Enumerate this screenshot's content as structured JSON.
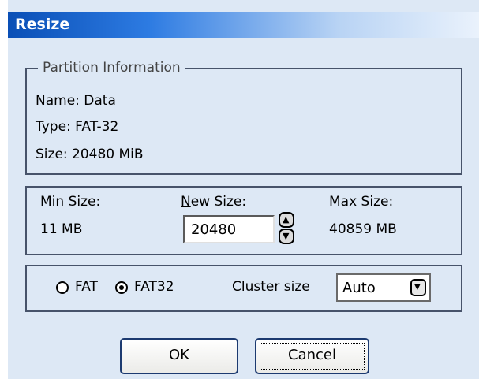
{
  "title": "Resize",
  "partition_info": {
    "legend": "Partition Information",
    "name": "Name: Data",
    "type": "Type: FAT-32",
    "size": "Size: 20480 MiB"
  },
  "sizes": {
    "min_label": "Min Size:",
    "min_value": "11 MB",
    "new_label": "New Size:",
    "new_value": "20480",
    "max_label": "Max Size:",
    "max_value": "40859 MB"
  },
  "fs": {
    "fat_label": "FAT",
    "fat32_label": "FAT32",
    "selected": "FAT32",
    "cluster_label": "Cluster size",
    "cluster_value": "Auto"
  },
  "buttons": {
    "ok": "OK",
    "cancel": "Cancel"
  },
  "icons": [
    "spin-up-icon",
    "spin-down-icon",
    "dropdown-arrow-icon",
    "radio-icon"
  ]
}
